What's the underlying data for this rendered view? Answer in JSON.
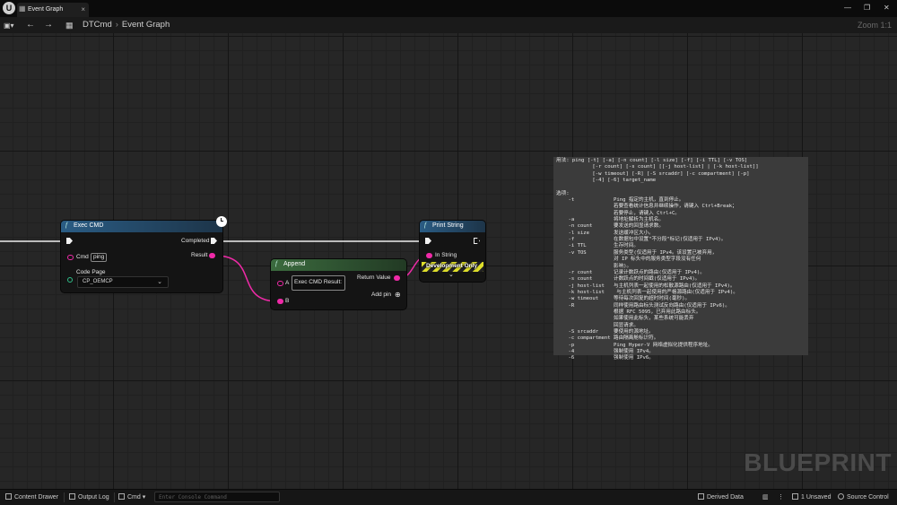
{
  "titlebar": {
    "logo": "U",
    "tab_label": "Event Graph",
    "tab_icon": "event-graph-icon",
    "tab_close": "×",
    "minimize": "—",
    "maximize": "❐",
    "close": "✕"
  },
  "navbar": {
    "back": "←",
    "forward": "→",
    "breadcrumb": [
      "DTCmd",
      "Event Graph"
    ],
    "breadcrumb_sep": "›",
    "zoom": "Zoom 1:1"
  },
  "nodes": {
    "exec_cmd": {
      "title": "Exec CMD",
      "icon": "f",
      "completed_label": "Completed",
      "result_label": "Result",
      "cmd_label": "Cmd",
      "cmd_value": "ping",
      "code_page_label": "Code Page",
      "code_page_value": "CP_OEMCP",
      "header_color": "#2a5c84"
    },
    "append": {
      "title": "Append",
      "icon": "f",
      "a_label": "A",
      "a_value": "Exec CMD Result:",
      "b_label": "B",
      "return_label": "Return Value",
      "add_pin_label": "Add pin",
      "header_color": "#3b6b3e"
    },
    "print_string": {
      "title": "Print String",
      "icon": "f",
      "in_string_label": "In String",
      "dev_only_label": "Development Only",
      "header_color": "#2a5c84"
    }
  },
  "console_output": "用法: ping [-t] [-a] [-n count] [-l size] [-f] [-i TTL] [-v TOS]\n            [-r count] [-s count] [[-j host-list] | [-k host-list]]\n            [-w timeout] [-R] [-S srcaddr] [-c compartment] [-p]\n            [-4] [-6] target_name\n\n选项:\n    -t             Ping 指定的主机，直到停止。\n                   若要查看统计信息并继续操作，请键入 Ctrl+Break；\n                   若要停止，请键入 Ctrl+C。\n    -a             将地址解析为主机名。\n    -n count       要发送的回显请求数。\n    -l size        发送缓冲区大小。\n    -f             在数据包中设置\"不分段\"标记(仅适用于 IPv4)。\n    -i TTL         生存时间。\n    -v TOS         服务类型(仅适用于 IPv4。该设置已被弃用，\n                   对 IP 标头中的服务类型字段没有任何\n                   影响)。\n    -r count       记录计数跃点的路由(仅适用于 IPv4)。\n    -s count       计数跃点的时间戳(仅适用于 IPv4)。\n    -j host-list   与主机列表一起使用的松散源路由(仅适用于 IPv4)。\n    -k host-list    与主机列表一起使用的严格源路由(仅适用于 IPv4)。\n    -w timeout     等待每次回复的超时时间(毫秒)。\n    -R             同样使用路由标头测试反向路由(仅适用于 IPv6)。\n                   根据 RFC 5095，已弃用此路由标头。\n                   如果使用此标头，某些系统可能丢弃\n                   回显请求。\n    -S srcaddr     要使用的源地址。\n    -c compartment 路由隔离舱标识符。\n    -p             Ping Hyper-V 网络虚拟化提供程序地址。\n    -4             强制使用 IPv4。\n    -6             强制使用 IPv6。",
  "watermark": "BLUEPRINT",
  "statusbar": {
    "content_drawer": "Content Drawer",
    "output_log": "Output Log",
    "cmd": "Cmd",
    "console_placeholder": "Enter Console Command",
    "derived_data": "Derived Data",
    "unsaved": "1 Unsaved",
    "source_control": "Source Control"
  }
}
